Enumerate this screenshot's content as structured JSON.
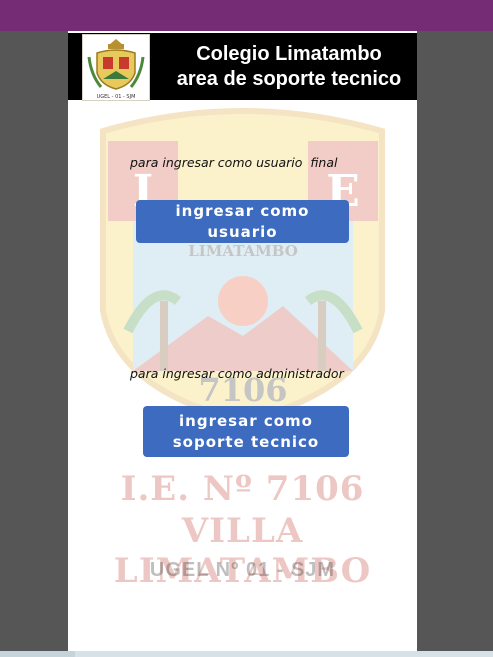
{
  "header": {
    "title_line1": "Colegio Limatambo",
    "title_line2": "area de soporte tecnico",
    "logo_caption": "UGEL - 01 - SJM"
  },
  "user_section": {
    "hint": "para ingresar como usuario  final",
    "button_label": "ingresar como usuario"
  },
  "admin_section": {
    "hint": "para ingresar como administrador",
    "button_label": "ingresar como soporte tecnico"
  },
  "watermark": {
    "letters": [
      "I",
      "E"
    ],
    "school_name": "LIMATAMBO",
    "number": "7106",
    "line1": "I.E. Nº 7106",
    "line2": "VILLA  LIMATAMBO",
    "line3": "UGEL  Nº 01 - SJM"
  },
  "colors": {
    "top_bar": "#762c74",
    "button": "#3c6bbf",
    "background": "#565656"
  }
}
